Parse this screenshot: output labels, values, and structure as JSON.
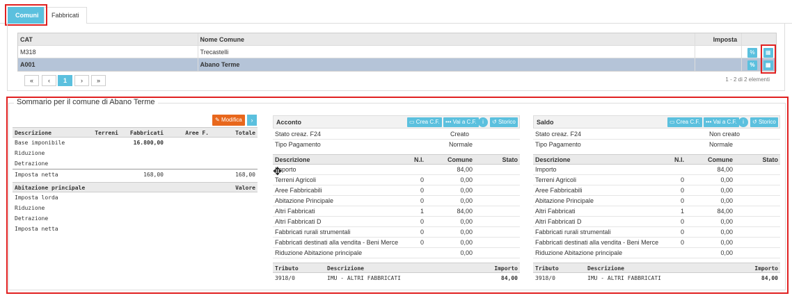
{
  "tabs": {
    "comuni": "Comuni",
    "fabbricati": "Fabbricati"
  },
  "grid": {
    "headers": {
      "cat": "CAT",
      "nome": "Nome Comune",
      "imposta": "Imposta"
    },
    "rows": [
      {
        "cat": "M318",
        "nome": "Trecastelli",
        "imposta": ""
      },
      {
        "cat": "A001",
        "nome": "Abano Terme",
        "imposta": ""
      }
    ],
    "pager": {
      "first": "«",
      "prev": "‹",
      "page": "1",
      "next": "›",
      "last": "»",
      "info": "1 - 2 di 2 elementi"
    }
  },
  "summary": {
    "title": "Sommario per il comune di Abano Terme",
    "modifica": "Modifica",
    "left": {
      "headers": {
        "descrizione": "Descrizione",
        "terreni": "Terreni",
        "fabbricati": "Fabbricati",
        "aree": "Aree F.",
        "totale": "Totale"
      },
      "rows": [
        {
          "desc": "Base imponibile",
          "terreni": "",
          "fabbricati": "16.800,00",
          "aree": "",
          "totale": ""
        },
        {
          "desc": "Riduzione",
          "terreni": "",
          "fabbricati": "",
          "aree": "",
          "totale": ""
        },
        {
          "desc": "Detrazione",
          "terreni": "",
          "fabbricati": "",
          "aree": "",
          "totale": ""
        },
        {
          "desc": "Imposta netta",
          "terreni": "",
          "fabbricati": "168,00",
          "aree": "",
          "totale": "168,00"
        }
      ],
      "abit_headers": {
        "descrizione": "Abitazione principale",
        "valore": "Valore"
      },
      "abit_rows": [
        "Imposta lorda",
        "Riduzione",
        "Detrazione",
        "Imposta netta"
      ]
    },
    "buttons": {
      "crea": "Crea C.F.",
      "vai": "Vai a C.F.",
      "info": "i",
      "storico": "Storico"
    },
    "acconto": {
      "title": "Acconto",
      "stato_label": "Stato creaz. F24",
      "stato_value": "Creato",
      "tipo_label": "Tipo Pagamento",
      "tipo_value": "Normale",
      "headers": {
        "descrizione": "Descrizione",
        "ni": "N.I.",
        "comune": "Comune",
        "stato": "Stato"
      },
      "rows": [
        {
          "desc": "Importo",
          "ni": "",
          "comune": "84,00"
        },
        {
          "desc": "Terreni Agricoli",
          "ni": "0",
          "comune": "0,00"
        },
        {
          "desc": "Aree Fabbricabili",
          "ni": "0",
          "comune": "0,00"
        },
        {
          "desc": "Abitazione Principale",
          "ni": "0",
          "comune": "0,00"
        },
        {
          "desc": "Altri Fabbricati",
          "ni": "1",
          "comune": "84,00"
        },
        {
          "desc": "Altri Fabbricati D",
          "ni": "0",
          "comune": "0,00"
        },
        {
          "desc": "Fabbricati rurali strumentali",
          "ni": "0",
          "comune": "0,00"
        },
        {
          "desc": "Fabbricati destinati alla vendita - Beni Merce",
          "ni": "0",
          "comune": "0,00"
        },
        {
          "desc": "Riduzione Abitazione principale",
          "ni": "",
          "comune": "0,00"
        }
      ],
      "tributo_headers": {
        "tributo": "Tributo",
        "descrizione": "Descrizione",
        "importo": "Importo"
      },
      "tributo_row": {
        "tributo": "3918/0",
        "descrizione": "IMU - ALTRI FABBRICATI",
        "importo": "84,00"
      }
    },
    "saldo": {
      "title": "Saldo",
      "stato_label": "Stato creaz. F24",
      "stato_value": "Non creato",
      "tipo_label": "Tipo Pagamento",
      "tipo_value": "Normale",
      "headers": {
        "descrizione": "Descrizione",
        "ni": "N.I.",
        "comune": "Comune",
        "stato": "Stato"
      },
      "rows": [
        {
          "desc": "Importo",
          "ni": "",
          "comune": "84,00"
        },
        {
          "desc": "Terreni Agricoli",
          "ni": "0",
          "comune": "0,00"
        },
        {
          "desc": "Aree Fabbricabili",
          "ni": "0",
          "comune": "0,00"
        },
        {
          "desc": "Abitazione Principale",
          "ni": "0",
          "comune": "0,00"
        },
        {
          "desc": "Altri Fabbricati",
          "ni": "1",
          "comune": "84,00"
        },
        {
          "desc": "Altri Fabbricati D",
          "ni": "0",
          "comune": "0,00"
        },
        {
          "desc": "Fabbricati rurali strumentali",
          "ni": "0",
          "comune": "0,00"
        },
        {
          "desc": "Fabbricati destinati alla vendita - Beni Merce",
          "ni": "0",
          "comune": "0,00"
        },
        {
          "desc": "Riduzione Abitazione principale",
          "ni": "",
          "comune": "0,00"
        }
      ],
      "tributo_headers": {
        "tributo": "Tributo",
        "descrizione": "Descrizione",
        "importo": "Importo"
      },
      "tributo_row": {
        "tributo": "3918/0",
        "descrizione": "IMU - ALTRI FABBRICATI",
        "importo": "84,00"
      }
    }
  }
}
